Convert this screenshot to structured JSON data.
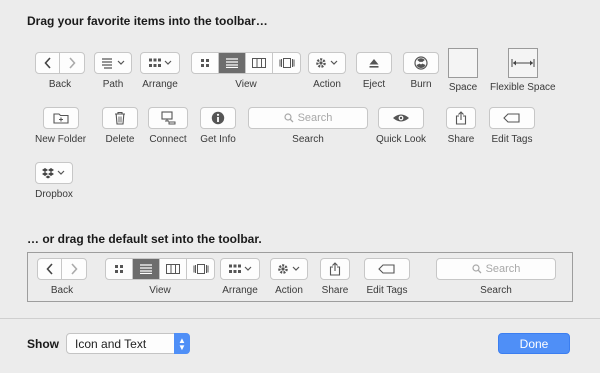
{
  "header": {
    "drag_title": "Drag your favorite items into the toolbar…",
    "default_title": "… or drag the default set into the toolbar."
  },
  "items": {
    "back": "Back",
    "path": "Path",
    "arrange": "Arrange",
    "view": "View",
    "action": "Action",
    "eject": "Eject",
    "burn": "Burn",
    "space": "Space",
    "flexible_space": "Flexible Space",
    "new_folder": "New Folder",
    "delete": "Delete",
    "connect": "Connect",
    "get_info": "Get Info",
    "search": "Search",
    "search_placeholder": "Search",
    "quick_look": "Quick Look",
    "share": "Share",
    "edit_tags": "Edit Tags",
    "dropbox": "Dropbox"
  },
  "default_set": {
    "back": "Back",
    "view": "View",
    "arrange": "Arrange",
    "action": "Action",
    "share": "Share",
    "edit_tags": "Edit Tags",
    "search": "Search",
    "search_placeholder": "Search"
  },
  "footer": {
    "show_label": "Show",
    "show_value": "Icon and Text",
    "done_label": "Done"
  },
  "colors": {
    "accent": "#4f8ff7",
    "selected_segment": "#6d6d6d"
  }
}
